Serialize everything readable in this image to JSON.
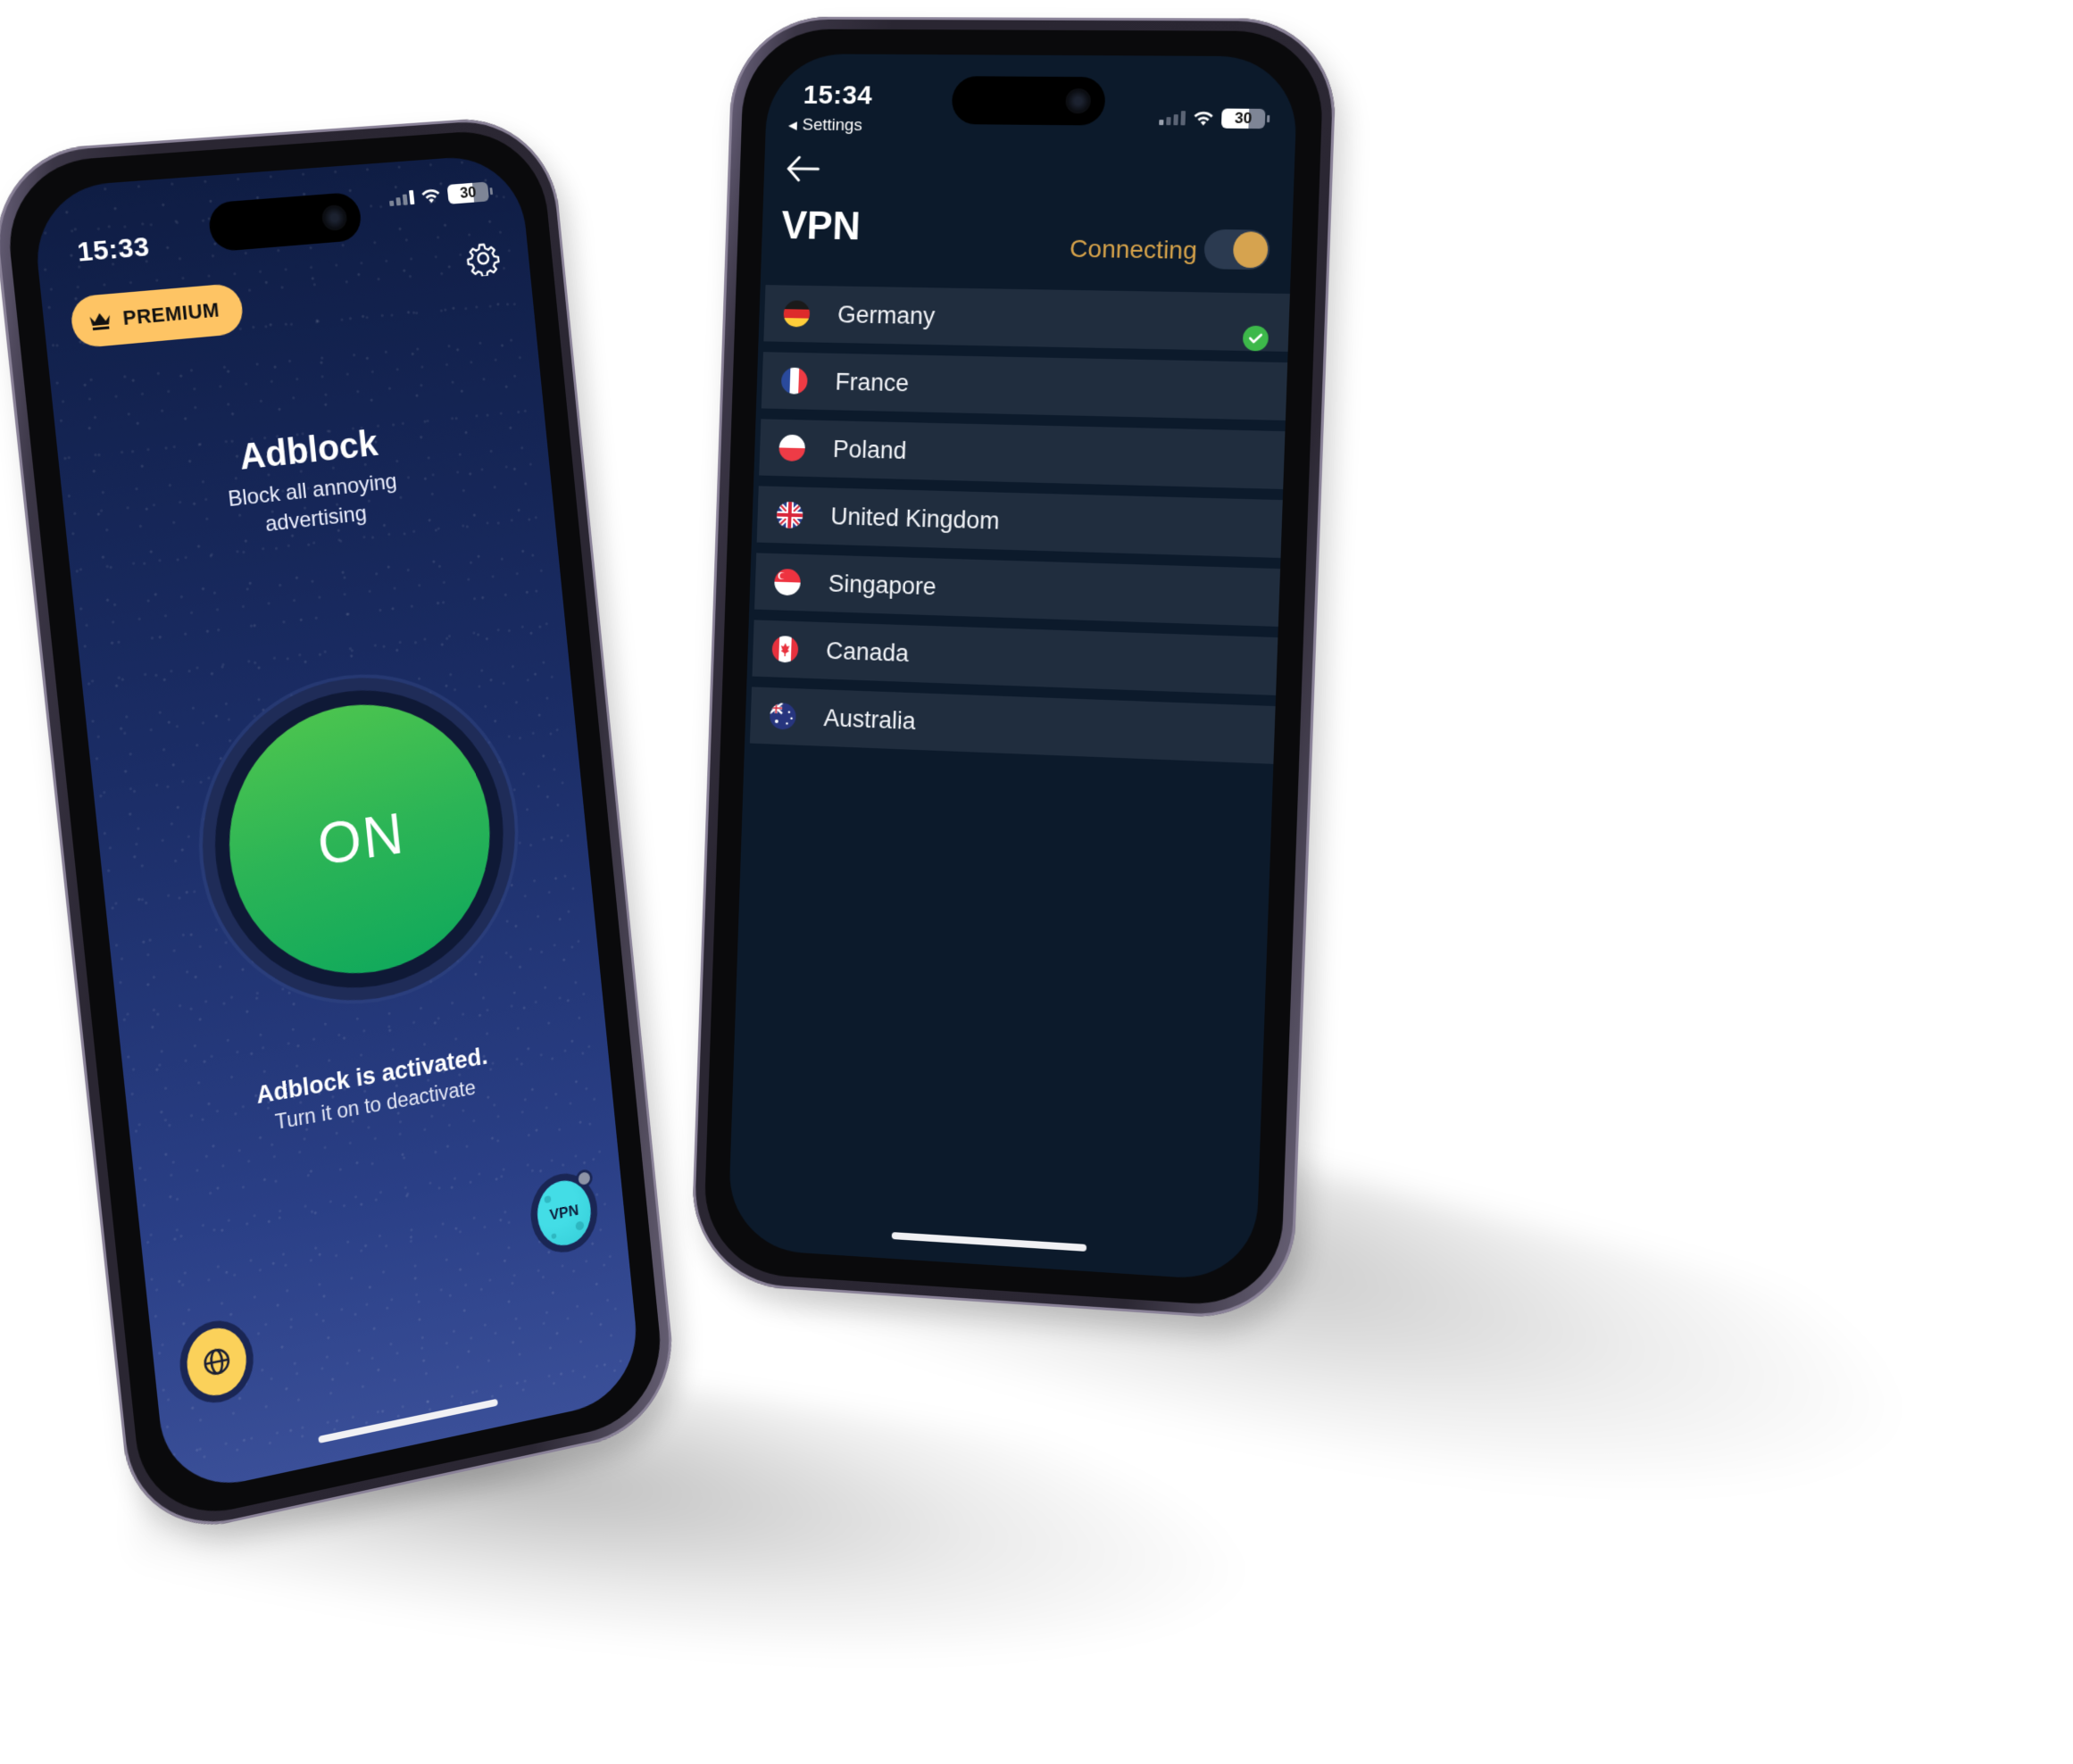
{
  "left_phone": {
    "status_bar": {
      "time": "15:33",
      "battery": "30"
    },
    "premium_badge": {
      "label": "PREMIUM",
      "icon": "crown-icon"
    },
    "settings_icon": "gear-icon",
    "hero": {
      "title": "Adblock",
      "subtitle_line1": "Block all annoying",
      "subtitle_line2": "advertising"
    },
    "toggle_button": {
      "label": "ON"
    },
    "state": {
      "title": "Adblock is activated.",
      "subtitle": "Turn it on to deactivate"
    },
    "bottom_left_button": {
      "icon": "globe-icon"
    },
    "bottom_right_button": {
      "label": "VPN"
    }
  },
  "right_phone": {
    "status_bar": {
      "time": "15:34",
      "back_app": "Settings",
      "battery": "30"
    },
    "header": {
      "back_icon": "arrow-left-icon",
      "title": "VPN",
      "status": "Connecting"
    },
    "vpn_toggle": {
      "state": "on"
    },
    "countries": [
      {
        "name": "Germany",
        "flag": "de",
        "selected": true
      },
      {
        "name": "France",
        "flag": "fr",
        "selected": false
      },
      {
        "name": "Poland",
        "flag": "pl",
        "selected": false
      },
      {
        "name": "United Kingdom",
        "flag": "gb",
        "selected": false
      },
      {
        "name": "Singapore",
        "flag": "sg",
        "selected": false
      },
      {
        "name": "Canada",
        "flag": "ca",
        "selected": false
      },
      {
        "name": "Australia",
        "flag": "au",
        "selected": false
      }
    ]
  },
  "colors": {
    "premium": "#fec464",
    "on_green": "#2bb456",
    "connecting": "#d7a34a",
    "vpn_bg": "#0c1a2b",
    "row_bg": "#202d3e",
    "check_green": "#3db84a"
  }
}
